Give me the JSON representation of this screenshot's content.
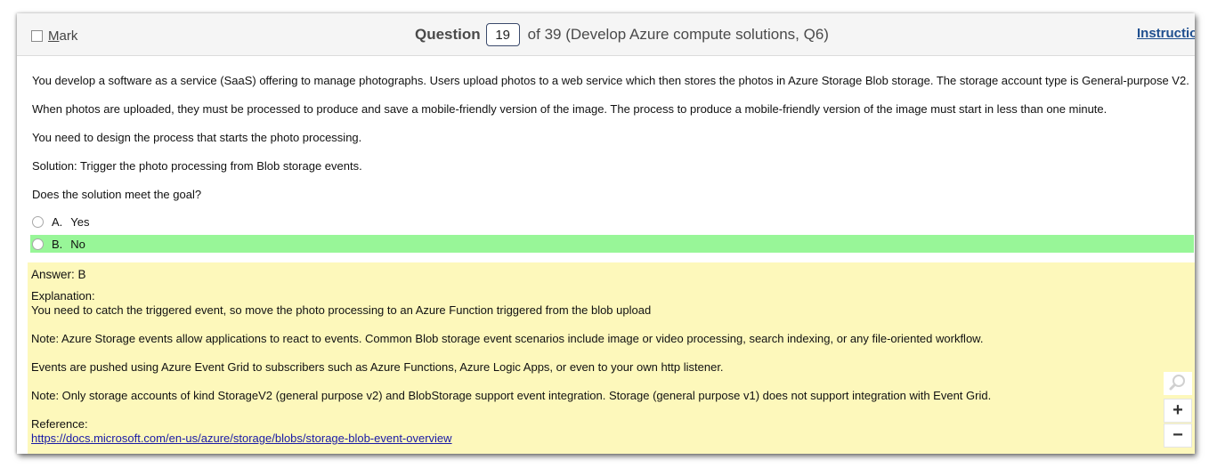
{
  "header": {
    "mark_label_first": "M",
    "mark_label_rest": "ark",
    "question_word": "Question",
    "question_number": "19",
    "question_suffix": "of 39 (Develop Azure compute solutions, Q6)",
    "instructions_link": "Instructions"
  },
  "question": {
    "paragraphs": [
      "You develop a software as a service (SaaS) offering to manage photographs. Users upload photos to a web service which then stores the photos in Azure Storage Blob storage. The storage account type is General-purpose V2.",
      "When photos are uploaded, they must be processed to produce and save a mobile-friendly version of the image. The process to produce a mobile-friendly version of the image must start in less than one minute.",
      "You need to design the process that starts the photo processing.",
      "Solution: Trigger the photo processing from Blob storage events.",
      "Does the solution meet the goal?"
    ],
    "options": [
      {
        "letter": "A.",
        "text": "Yes",
        "highlighted": false
      },
      {
        "letter": "B.",
        "text": "No",
        "highlighted": true
      }
    ]
  },
  "answer": {
    "answer_line": "Answer: B",
    "explanation_label": "Explanation:",
    "lines": [
      "You need to catch the triggered event, so move the photo processing to an Azure Function triggered from the blob upload",
      "Note: Azure Storage events allow applications to react to events. Common Blob storage event scenarios include image or video processing, search indexing, or any file-oriented workflow.",
      "Events are pushed using Azure Event Grid to subscribers such as Azure Functions, Azure Logic Apps, or even to your own http listener.",
      "Note: Only storage accounts of kind StorageV2 (general purpose v2) and BlobStorage support event integration. Storage (general purpose v1) does not support integration with Event Grid."
    ],
    "reference_label": "Reference:",
    "reference_url": "https://docs.microsoft.com/en-us/azure/storage/blobs/storage-blob-event-overview"
  },
  "zoom": {
    "search_icon": "magnifier-icon",
    "zoom_in": "+",
    "zoom_out": "−"
  },
  "colors": {
    "correct_highlight": "#98f698",
    "answer_panel": "#fdf8bb",
    "link": "#1a1aa6",
    "instructions": "#1f4f8f"
  }
}
